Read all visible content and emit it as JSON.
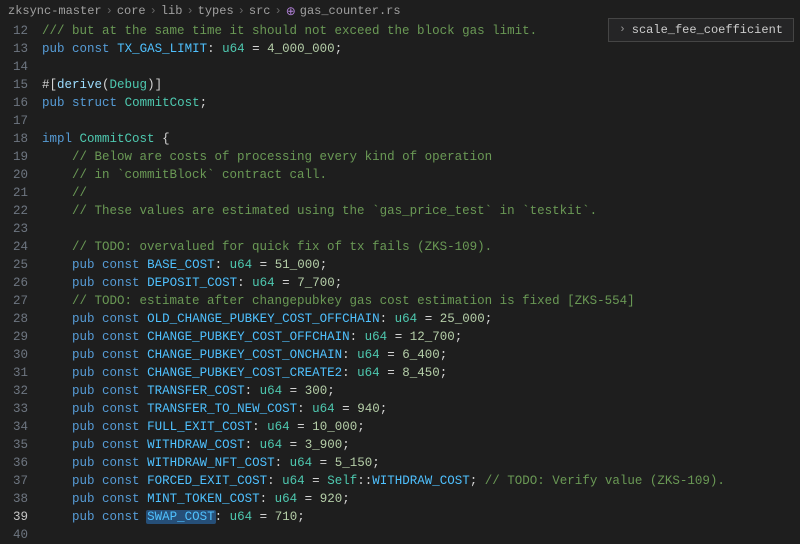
{
  "breadcrumb": {
    "items": [
      "zksync-master",
      "core",
      "lib",
      "types",
      "src",
      "gas_counter.rs"
    ]
  },
  "reference": {
    "label": "scale_fee_coefficient"
  },
  "lines": {
    "l12_comment": "/// but at the same time it should not exceed the block gas limit.",
    "l13_kw1": "pub",
    "l13_kw2": "const",
    "l13_name": "TX_GAS_LIMIT",
    "l13_type": "u64",
    "l13_val": "4_000_000",
    "l15_attr_open": "#[",
    "l15_derive": "derive",
    "l15_debug": "Debug",
    "l15_close": ")]",
    "l16_kw1": "pub",
    "l16_kw2": "struct",
    "l16_name": "CommitCost",
    "l18_kw": "impl",
    "l18_name": "CommitCost",
    "l19_c": "// Below are costs of processing every kind of operation",
    "l20_c": "// in `commitBlock` contract call.",
    "l21_c": "//",
    "l22_c": "// These values are estimated using the `gas_price_test` in `testkit`.",
    "l24_c": "// TODO: overvalued for quick fix of tx fails (ZKS-109).",
    "l25_kw1": "pub",
    "l25_kw2": "const",
    "l25_name": "BASE_COST",
    "l25_type": "u64",
    "l25_val": "51_000",
    "l26_kw1": "pub",
    "l26_kw2": "const",
    "l26_name": "DEPOSIT_COST",
    "l26_type": "u64",
    "l26_val": "7_700",
    "l27_c": "// TODO: estimate after changepubkey gas cost estimation is fixed [ZKS-554]",
    "l28_kw1": "pub",
    "l28_kw2": "const",
    "l28_name": "OLD_CHANGE_PUBKEY_COST_OFFCHAIN",
    "l28_type": "u64",
    "l28_val": "25_000",
    "l29_kw1": "pub",
    "l29_kw2": "const",
    "l29_name": "CHANGE_PUBKEY_COST_OFFCHAIN",
    "l29_type": "u64",
    "l29_val": "12_700",
    "l30_kw1": "pub",
    "l30_kw2": "const",
    "l30_name": "CHANGE_PUBKEY_COST_ONCHAIN",
    "l30_type": "u64",
    "l30_val": "6_400",
    "l31_kw1": "pub",
    "l31_kw2": "const",
    "l31_name": "CHANGE_PUBKEY_COST_CREATE2",
    "l31_type": "u64",
    "l31_val": "8_450",
    "l32_kw1": "pub",
    "l32_kw2": "const",
    "l32_name": "TRANSFER_COST",
    "l32_type": "u64",
    "l32_val": "300",
    "l33_kw1": "pub",
    "l33_kw2": "const",
    "l33_name": "TRANSFER_TO_NEW_COST",
    "l33_type": "u64",
    "l33_val": "940",
    "l34_kw1": "pub",
    "l34_kw2": "const",
    "l34_name": "FULL_EXIT_COST",
    "l34_type": "u64",
    "l34_val": "10_000",
    "l35_kw1": "pub",
    "l35_kw2": "const",
    "l35_name": "WITHDRAW_COST",
    "l35_type": "u64",
    "l35_val": "3_900",
    "l36_kw1": "pub",
    "l36_kw2": "const",
    "l36_name": "WITHDRAW_NFT_COST",
    "l36_type": "u64",
    "l36_val": "5_150",
    "l37_kw1": "pub",
    "l37_kw2": "const",
    "l37_name": "FORCED_EXIT_COST",
    "l37_type": "u64",
    "l37_self": "Self",
    "l37_ref": "WITHDRAW_COST",
    "l37_c": "// TODO: Verify value (ZKS-109).",
    "l38_kw1": "pub",
    "l38_kw2": "const",
    "l38_name": "MINT_TOKEN_COST",
    "l38_type": "u64",
    "l38_val": "920",
    "l39_kw1": "pub",
    "l39_kw2": "const",
    "l39_name": "SWAP_COST",
    "l39_type": "u64",
    "l39_val": "710"
  },
  "line_numbers": [
    12,
    13,
    14,
    15,
    16,
    17,
    18,
    19,
    20,
    21,
    22,
    23,
    24,
    25,
    26,
    27,
    28,
    29,
    30,
    31,
    32,
    33,
    34,
    35,
    36,
    37,
    38,
    39,
    40
  ]
}
